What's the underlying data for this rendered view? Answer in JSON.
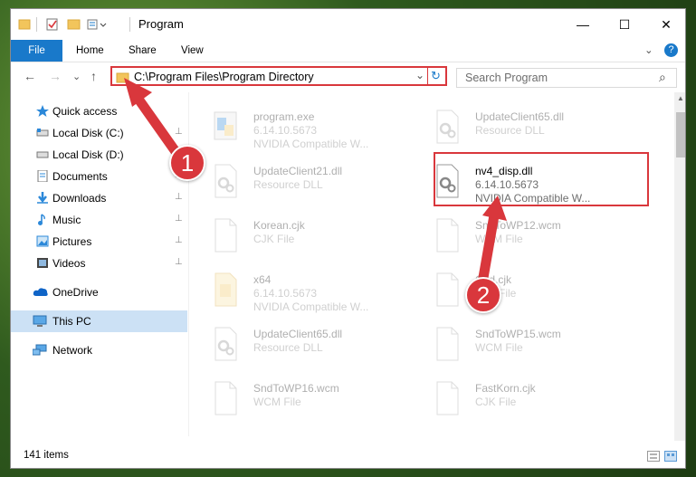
{
  "window": {
    "title": "Program",
    "minimize_glyph": "—",
    "maximize_glyph": "☐",
    "close_glyph": "✕"
  },
  "ribbon": {
    "tabs": [
      "File",
      "Home",
      "Share",
      "View"
    ],
    "expand_glyph": "⌄",
    "help_glyph": "?"
  },
  "address_bar": {
    "back_glyph": "←",
    "forward_glyph": "→",
    "recent_glyph": "⌄",
    "up_glyph": "↑",
    "path": "C:\\Program Files\\Program Directory",
    "dropdown_glyph": "⌄",
    "refresh_glyph": "↻"
  },
  "search": {
    "placeholder": "Search Program",
    "icon_glyph": "⌕"
  },
  "nav": {
    "items": [
      {
        "label": "Quick access",
        "icon": "star-icon",
        "pinned": false
      },
      {
        "label": "Local Disk (C:)",
        "icon": "drive-icon",
        "pinned": true
      },
      {
        "label": "Local Disk (D:)",
        "icon": "drive-icon",
        "pinned": true
      },
      {
        "label": "Documents",
        "icon": "document-icon",
        "pinned": true
      },
      {
        "label": "Downloads",
        "icon": "download-icon",
        "pinned": true
      },
      {
        "label": "Music",
        "icon": "music-icon",
        "pinned": true
      },
      {
        "label": "Pictures",
        "icon": "pictures-icon",
        "pinned": true
      },
      {
        "label": "Videos",
        "icon": "videos-icon",
        "pinned": true
      },
      {
        "label": "OneDrive",
        "icon": "cloud-icon",
        "pinned": false
      },
      {
        "label": "This PC",
        "icon": "computer-icon",
        "pinned": false,
        "selected": true
      },
      {
        "label": "Network",
        "icon": "network-icon",
        "pinned": false
      }
    ],
    "pin_glyph": "📌"
  },
  "files": [
    {
      "name": "program.exe",
      "line2": "6.14.10.5673",
      "line3": "NVIDIA Compatible W...",
      "icon": "exe-icon",
      "faded": true
    },
    {
      "name": "UpdateClient65.dll",
      "line2": "Resource DLL",
      "line3": "",
      "icon": "dll-icon",
      "faded": true
    },
    {
      "name": "UpdateClient21.dll",
      "line2": "Resource DLL",
      "line3": "",
      "icon": "dll-icon",
      "faded": true
    },
    {
      "name": "nv4_disp.dll",
      "line2": "6.14.10.5673",
      "line3": "NVIDIA Compatible W...",
      "icon": "dll-icon",
      "faded": false,
      "highlighted": true
    },
    {
      "name": "Korean.cjk",
      "line2": "CJK File",
      "line3": "",
      "icon": "file-icon",
      "faded": true
    },
    {
      "name": "SndToWP12.wcm",
      "line2": "WCM File",
      "line3": "",
      "icon": "file-icon",
      "faded": true
    },
    {
      "name": "x64",
      "line2": "6.14.10.5673",
      "line3": "NVIDIA Compatible W...",
      "icon": "folder-file-icon",
      "faded": true
    },
    {
      "name": "Cnd.cjk",
      "line2": "CJK File",
      "line3": "",
      "icon": "file-icon",
      "faded": true
    },
    {
      "name": "UpdateClient65.dll",
      "line2": "Resource DLL",
      "line3": "",
      "icon": "dll-icon",
      "faded": true
    },
    {
      "name": "SndToWP15.wcm",
      "line2": "WCM File",
      "line3": "",
      "icon": "file-icon",
      "faded": true
    },
    {
      "name": "SndToWP16.wcm",
      "line2": "WCM File",
      "line3": "",
      "icon": "file-icon",
      "faded": true
    },
    {
      "name": "FastKorn.cjk",
      "line2": "CJK File",
      "line3": "",
      "icon": "file-icon",
      "faded": true
    }
  ],
  "status": {
    "item_count": "141 items"
  },
  "callouts": [
    "1",
    "2"
  ],
  "colors": {
    "accent": "#1979ca",
    "highlight": "#d9373c",
    "selection": "#cce1f5"
  }
}
